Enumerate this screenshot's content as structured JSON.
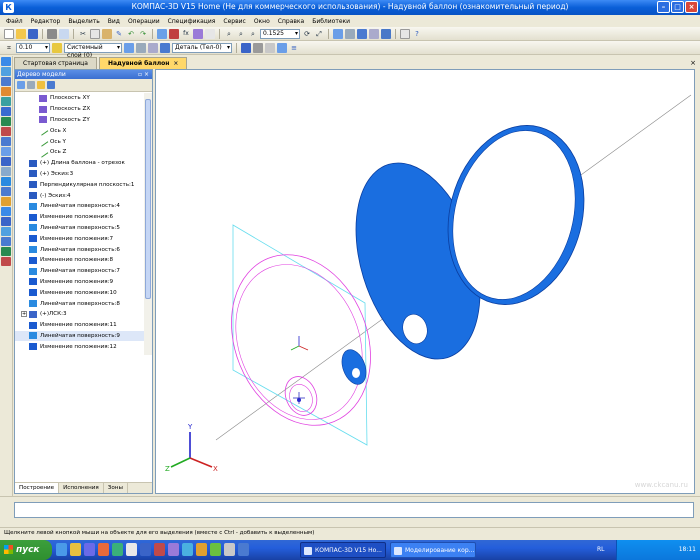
{
  "window": {
    "title": "КОМПАС-3D V15 Home (Не для коммерческого использования) - Надувной баллон (ознакомительный период)"
  },
  "menu": [
    "Файл",
    "Редактор",
    "Выделить",
    "Вид",
    "Операции",
    "Спецификация",
    "Сервис",
    "Окно",
    "Справка",
    "Библиотеки"
  ],
  "toolbar": {
    "zoom_value": "0.1525",
    "line_width": "0.10",
    "layer": "Системный слой (0)",
    "part": "Деталь (Тел-0)"
  },
  "tabs": [
    {
      "label": "Стартовая страница",
      "active": false
    },
    {
      "label": "Надувной баллон",
      "active": true,
      "close": "×"
    }
  ],
  "tree": {
    "header": "Дерево модели",
    "pin": "▫ ×",
    "items": [
      {
        "label": "Плоскость XY",
        "icon": "plane-icon",
        "indent": 3
      },
      {
        "label": "Плоскость ZX",
        "icon": "plane-icon",
        "indent": 3
      },
      {
        "label": "Плоскость ZY",
        "icon": "plane-icon",
        "indent": 3
      },
      {
        "label": "Ось X",
        "icon": "axis-icon",
        "indent": 3
      },
      {
        "label": "Ось Y",
        "icon": "axis-icon",
        "indent": 3
      },
      {
        "label": "Ось Z",
        "icon": "axis-icon",
        "indent": 3
      },
      {
        "label": "(+) Длина баллона - отрезок",
        "icon": "sketch-icon",
        "indent": 2
      },
      {
        "label": "(+) Эскиз:3",
        "icon": "sketch-icon",
        "indent": 2
      },
      {
        "label": "Перпендикулярная плоскость:1",
        "icon": "sketch-icon",
        "indent": 2
      },
      {
        "label": "(-) Эскиз:4",
        "icon": "sketch-icon",
        "indent": 2
      },
      {
        "label": "Линейчатая поверхность:4",
        "icon": "surface-icon",
        "indent": 2
      },
      {
        "label": "Изменение положения:6",
        "icon": "move-icon",
        "indent": 2
      },
      {
        "label": "Линейчатая поверхность:5",
        "icon": "surface-icon",
        "indent": 2
      },
      {
        "label": "Изменение положения:7",
        "icon": "move-icon",
        "indent": 2
      },
      {
        "label": "Линейчатая поверхность:6",
        "icon": "surface-icon",
        "indent": 2
      },
      {
        "label": "Изменение положения:8",
        "icon": "move-icon",
        "indent": 2
      },
      {
        "label": "Линейчатая поверхность:7",
        "icon": "surface-icon",
        "indent": 2
      },
      {
        "label": "Изменение положения:9",
        "icon": "move-icon",
        "indent": 2
      },
      {
        "label": "Изменение положения:10",
        "icon": "move-icon",
        "indent": 2
      },
      {
        "label": "Линейчатая поверхность:8",
        "icon": "surface-icon",
        "indent": 2
      },
      {
        "label": "(+)ЛСК:3",
        "icon": "lcs-icon",
        "indent": 2,
        "expander": "+"
      },
      {
        "label": "Изменение положения:11",
        "icon": "move-icon",
        "indent": 2
      },
      {
        "label": "Линейчатая поверхность:9",
        "icon": "surface-icon",
        "indent": 2,
        "selected": true
      },
      {
        "label": "Изменение положения:12",
        "icon": "move-icon",
        "indent": 2
      }
    ],
    "bottom_tabs": [
      "Построение",
      "Исполнения",
      "Зоны"
    ]
  },
  "viewport": {
    "axis_labels": {
      "x": "X",
      "y": "Y",
      "z": "Z"
    },
    "watermark": "www.ckcanu.ru"
  },
  "status": {
    "hint": "Щелкните левой кнопкой мыши на объекте для его выделения (вместе с Ctrl - добавить к выделенным)"
  },
  "taskbar": {
    "start_label": "пуск",
    "tasks": [
      "КОМПАС-3D V15 Ho...",
      "Моделирование кор..."
    ],
    "lang": "RL",
    "clock": "18:11"
  },
  "colors": {
    "accent_blue": "#1a6ee0",
    "sketch_magenta": "#e040e0",
    "plane_cyan": "#66ddee"
  }
}
